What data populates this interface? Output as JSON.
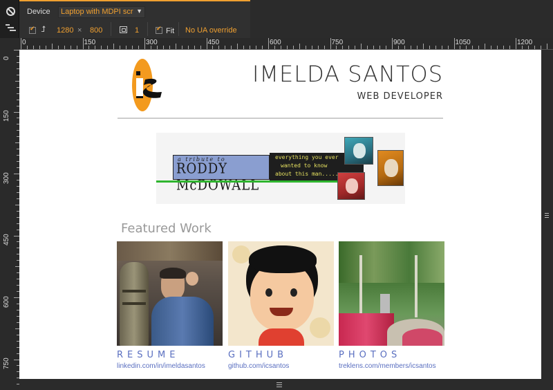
{
  "toolbar": {
    "device_label": "Device",
    "device_select": "Laptop with MDPI scr",
    "width": "1280",
    "times": "×",
    "height": "800",
    "scale": "1",
    "fit_label": "Fit",
    "ua_label": "No UA override"
  },
  "ruler": {
    "h_labels": [
      "0",
      "150",
      "300",
      "450",
      "600",
      "750",
      "900",
      "1050",
      "1200"
    ],
    "v_labels": [
      "0",
      "150",
      "300",
      "450",
      "600",
      "750"
    ]
  },
  "page": {
    "logo_text": "is",
    "name": "IMELDA SANTOS",
    "subtitle": "WEB DEVELOPER",
    "banner": {
      "tribute_line1": "a tribute to",
      "tribute_line2": "RODDY McDOWALL",
      "line1": "everything you ever",
      "line2": "wanted to know",
      "line3": "about this man....."
    },
    "featured_heading": "Featured Work",
    "cards": [
      {
        "title": "RESUME",
        "url": "linkedin.com/in/imeldasantos"
      },
      {
        "title": "GITHUB",
        "url": "github.com/icsantos"
      },
      {
        "title": "PHOTOS",
        "url": "treklens.com/members/icsantos"
      }
    ]
  },
  "colors": {
    "accent": "#f0a030",
    "link": "#5a6fc0",
    "logo_orange": "#f39a1e"
  }
}
